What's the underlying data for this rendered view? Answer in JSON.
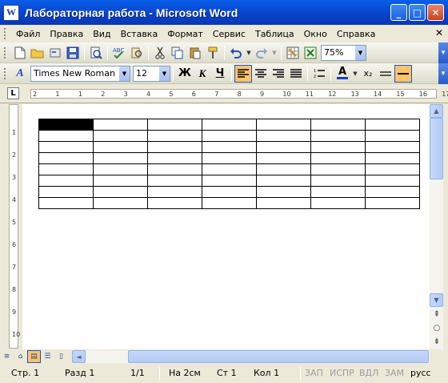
{
  "window": {
    "title": "Лабораторная работа - Microsoft Word",
    "app_icon": "W",
    "buttons": {
      "minimize": "_",
      "maximize": "□",
      "close": "✕"
    }
  },
  "menu": {
    "items": [
      {
        "label": "Файл"
      },
      {
        "label": "Правка"
      },
      {
        "label": "Вид"
      },
      {
        "label": "Вставка"
      },
      {
        "label": "Формат"
      },
      {
        "label": "Сервис"
      },
      {
        "label": "Таблица"
      },
      {
        "label": "Окно"
      },
      {
        "label": "Справка"
      }
    ],
    "close": "✕"
  },
  "standard_toolbar": {
    "icons": [
      "new-doc-icon",
      "open-folder-icon",
      "permission-icon",
      "save-icon",
      "print-preview-icon",
      "spelling-icon",
      "research-icon",
      "cut-icon",
      "copy-icon",
      "paste-icon",
      "format-painter-icon",
      "undo-icon",
      "redo-icon",
      "insert-table-icon",
      "excel-icon"
    ],
    "zoom": "75%"
  },
  "formatting_toolbar": {
    "style_icon": "A",
    "font": "Times New Roman",
    "size": "12",
    "bold": "Ж",
    "italic": "К",
    "underline": "Ч",
    "font_color": "A",
    "subscript": "x₂",
    "active_alignment": "left",
    "accent_color": "#ffc36a",
    "font_color_value": "#1e3cc8"
  },
  "ruler": {
    "horizontal_ticks": [
      "2",
      "1",
      "1",
      "2",
      "3",
      "4",
      "5",
      "6",
      "7",
      "8",
      "9",
      "10",
      "11",
      "12",
      "13",
      "14",
      "15",
      "16",
      "17"
    ],
    "vertical_ticks": [
      "1",
      "2",
      "3",
      "4",
      "5",
      "6",
      "7",
      "8",
      "9",
      "10"
    ],
    "tab_selector": "L"
  },
  "document": {
    "table": {
      "rows": 8,
      "cols": 7,
      "selected_cell": [
        0,
        0
      ]
    }
  },
  "status": {
    "page": "Стр. 1",
    "section": "Разд  1",
    "pages": "1/1",
    "at": "На  2см",
    "line": "Ст  1",
    "col": "Кол  1",
    "rec": "ЗАП",
    "trk": "ИСПР",
    "ext": "ВДЛ",
    "ovr": "ЗАМ",
    "lang": "русс"
  }
}
